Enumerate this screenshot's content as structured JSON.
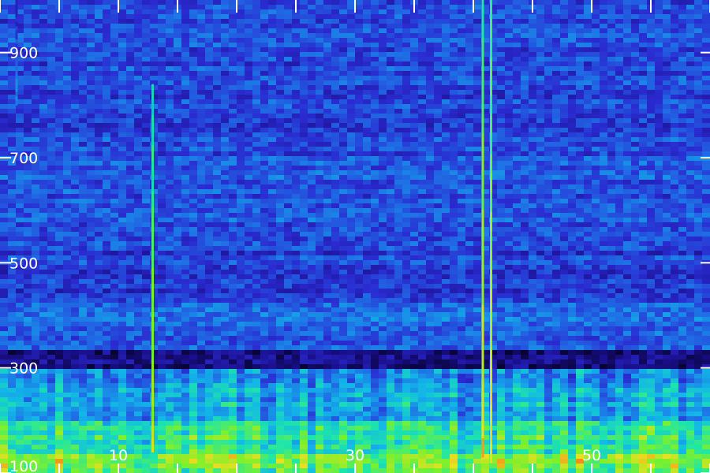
{
  "chart_data": {
    "type": "heatmap",
    "title": "",
    "xlabel": "",
    "ylabel": "",
    "xlim": [
      0,
      60
    ],
    "ylim": [
      100,
      1000
    ],
    "x_tick_values": [
      0,
      5,
      10,
      15,
      20,
      25,
      30,
      35,
      40,
      45,
      50,
      55,
      60
    ],
    "x_tick_labels": [
      {
        "value": 10,
        "label": "10"
      },
      {
        "value": 30,
        "label": "30"
      },
      {
        "value": 50,
        "label": "50"
      }
    ],
    "y_tick_labels": [
      {
        "value": 100,
        "label": "100"
      },
      {
        "value": 300,
        "label": "300"
      },
      {
        "value": 500,
        "label": "500"
      },
      {
        "value": 700,
        "label": "700"
      },
      {
        "value": 900,
        "label": "900"
      }
    ],
    "colormap": [
      "#05022a",
      "#1a0f8c",
      "#2a2bd0",
      "#1f6fe6",
      "#12b6e8",
      "#1ee6a8",
      "#7cf02c",
      "#e8e020",
      "#ff2a10"
    ],
    "background_level": 0.3,
    "bands": [
      {
        "y_from": 100,
        "y_to": 140,
        "level": 0.72
      },
      {
        "y_from": 140,
        "y_to": 200,
        "level": 0.62
      },
      {
        "y_from": 200,
        "y_to": 260,
        "level": 0.48
      },
      {
        "y_from": 260,
        "y_to": 300,
        "level": 0.42
      },
      {
        "y_from": 300,
        "y_to": 330,
        "level": 0.12
      },
      {
        "y_from": 330,
        "y_to": 420,
        "level": 0.36
      },
      {
        "y_from": 420,
        "y_to": 520,
        "level": 0.28
      },
      {
        "y_from": 520,
        "y_to": 700,
        "level": 0.32
      },
      {
        "y_from": 700,
        "y_to": 1000,
        "level": 0.3
      }
    ],
    "vertical_lines": [
      {
        "x": 12.9,
        "y_from": 140,
        "y_to": 840,
        "level": 0.82
      },
      {
        "x": 40.8,
        "y_from": 130,
        "y_to": 1000,
        "level": 0.9
      },
      {
        "x": 41.5,
        "y_from": 120,
        "y_to": 1000,
        "level": 0.88
      },
      {
        "x": 1.4,
        "y_from": 800,
        "y_to": 1000,
        "level": 0.45
      }
    ]
  }
}
